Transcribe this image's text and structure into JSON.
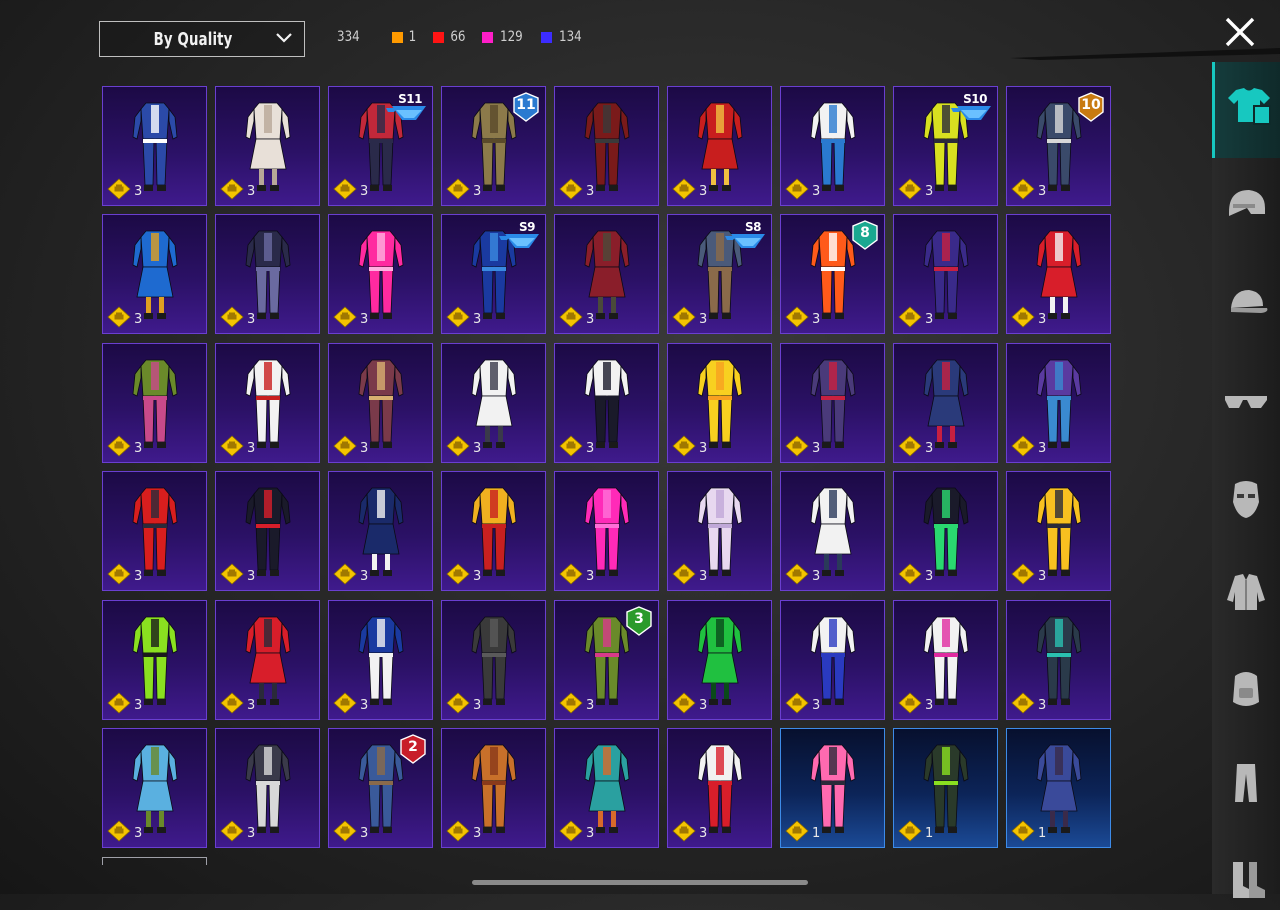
{
  "header": {
    "sort_label": "By Quality",
    "total": "334",
    "counts": [
      {
        "value": "1",
        "color": "#ff9a00"
      },
      {
        "value": "66",
        "color": "#ff1414"
      },
      {
        "value": "129",
        "color": "#ff1ec8"
      },
      {
        "value": "134",
        "color": "#3c2cff"
      }
    ]
  },
  "colors": {
    "accent": "#17c8c0",
    "tile_purple": "#3f1a8c",
    "tile_blue": "#1b4a96",
    "badge_gold": "#f4c400"
  },
  "sidebar": {
    "items": [
      {
        "icon": "outfit-icon",
        "active": true
      },
      {
        "icon": "helmet-icon",
        "active": false
      },
      {
        "icon": "cap-icon",
        "active": false
      },
      {
        "icon": "glasses-icon",
        "active": false
      },
      {
        "icon": "mask-icon",
        "active": false
      },
      {
        "icon": "jacket-icon",
        "active": false
      },
      {
        "icon": "backpack-icon",
        "active": false
      },
      {
        "icon": "pants-icon",
        "active": false
      },
      {
        "icon": "boots-icon",
        "active": false
      }
    ]
  },
  "items": [
    {
      "qty": "3",
      "tier": "purple",
      "color": "#2b4aa8",
      "accent": "#ffffff"
    },
    {
      "qty": "3",
      "tier": "purple",
      "color": "#e8e0d8",
      "accent": "#b8a898"
    },
    {
      "qty": "3",
      "tier": "purple",
      "color": "#c2283a",
      "accent": "#2a2a4a",
      "season": "S11"
    },
    {
      "qty": "3",
      "tier": "purple",
      "color": "#8c7a4a",
      "accent": "#5a4a2a",
      "rank": "11"
    },
    {
      "qty": "3",
      "tier": "purple",
      "color": "#7a1a1a",
      "accent": "#3a3a3a"
    },
    {
      "qty": "3",
      "tier": "purple",
      "color": "#c81e1e",
      "accent": "#f0c040"
    },
    {
      "qty": "3",
      "tier": "purple",
      "color": "#f2f2f2",
      "accent": "#2a7ad0"
    },
    {
      "qty": "3",
      "tier": "purple",
      "color": "#d8e020",
      "accent": "#2a2a3a",
      "season": "S10"
    },
    {
      "qty": "3",
      "tier": "purple",
      "color": "#3a4a6a",
      "accent": "#d8d8d8",
      "rank": "10"
    },
    {
      "qty": "3",
      "tier": "purple",
      "color": "#1e6ad0",
      "accent": "#e0a020"
    },
    {
      "qty": "3",
      "tier": "purple",
      "color": "#2a2a4a",
      "accent": "#6a6aa0"
    },
    {
      "qty": "3",
      "tier": "purple",
      "color": "#ff2aa0",
      "accent": "#ffb0e0"
    },
    {
      "qty": "3",
      "tier": "purple",
      "color": "#1a3aa0",
      "accent": "#3a8ae0",
      "season": "S9"
    },
    {
      "qty": "3",
      "tier": "purple",
      "color": "#8a1e2a",
      "accent": "#4a4a3a"
    },
    {
      "qty": "3",
      "tier": "purple",
      "color": "#4a5a7a",
      "accent": "#8a6a4a",
      "season": "S8"
    },
    {
      "qty": "3",
      "tier": "purple",
      "color": "#ff5a1a",
      "accent": "#ffffff",
      "rank": "8"
    },
    {
      "qty": "3",
      "tier": "purple",
      "color": "#3a2a8a",
      "accent": "#c82040"
    },
    {
      "qty": "3",
      "tier": "purple",
      "color": "#d81e2a",
      "accent": "#f2f2f2"
    },
    {
      "qty": "3",
      "tier": "purple",
      "color": "#6a8a2a",
      "accent": "#c84a8a"
    },
    {
      "qty": "3",
      "tier": "purple",
      "color": "#f2f2f2",
      "accent": "#c81e1e"
    },
    {
      "qty": "3",
      "tier": "purple",
      "color": "#7a3a4a",
      "accent": "#d8b070"
    },
    {
      "qty": "3",
      "tier": "purple",
      "color": "#f2f2f2",
      "accent": "#3a3a4a"
    },
    {
      "qty": "3",
      "tier": "purple",
      "color": "#f2f2f2",
      "accent": "#1a1a2a"
    },
    {
      "qty": "3",
      "tier": "purple",
      "color": "#f8d020",
      "accent": "#f8a020"
    },
    {
      "qty": "3",
      "tier": "purple",
      "color": "#4a3a7a",
      "accent": "#c82040"
    },
    {
      "qty": "3",
      "tier": "purple",
      "color": "#2a3a7a",
      "accent": "#c82040"
    },
    {
      "qty": "3",
      "tier": "purple",
      "color": "#5a3aa0",
      "accent": "#3a8ad0"
    },
    {
      "qty": "3",
      "tier": "purple",
      "color": "#d81e1e",
      "accent": "#2a2a3a"
    },
    {
      "qty": "3",
      "tier": "purple",
      "color": "#1a1a2a",
      "accent": "#d81e2a"
    },
    {
      "qty": "3",
      "tier": "purple",
      "color": "#1a2a6a",
      "accent": "#f2f2f2"
    },
    {
      "qty": "3",
      "tier": "purple",
      "color": "#f0b020",
      "accent": "#c82020"
    },
    {
      "qty": "3",
      "tier": "purple",
      "color": "#ff2ab8",
      "accent": "#ff70d8"
    },
    {
      "qty": "3",
      "tier": "purple",
      "color": "#e8d8f0",
      "accent": "#c0a8d8"
    },
    {
      "qty": "3",
      "tier": "purple",
      "color": "#f2f2f2",
      "accent": "#2a3a5a"
    },
    {
      "qty": "3",
      "tier": "purple",
      "color": "#1a1a2a",
      "accent": "#2ad870"
    },
    {
      "qty": "3",
      "tier": "purple",
      "color": "#f8c020",
      "accent": "#2a2a3a"
    },
    {
      "qty": "3",
      "tier": "purple",
      "color": "#8ae020",
      "accent": "#1a1a1a"
    },
    {
      "qty": "3",
      "tier": "purple",
      "color": "#d81e2a",
      "accent": "#2a2a3a"
    },
    {
      "qty": "3",
      "tier": "purple",
      "color": "#1a3aa0",
      "accent": "#f2f2f2"
    },
    {
      "qty": "3",
      "tier": "purple",
      "color": "#3a3a3a",
      "accent": "#5a5a5a"
    },
    {
      "qty": "3",
      "tier": "purple",
      "color": "#6a8a2a",
      "accent": "#d83a8a",
      "rank": "3"
    },
    {
      "qty": "3",
      "tier": "purple",
      "color": "#20c040",
      "accent": "#0a4a1a"
    },
    {
      "qty": "3",
      "tier": "purple",
      "color": "#f2f2f2",
      "accent": "#2a3ac0"
    },
    {
      "qty": "3",
      "tier": "purple",
      "color": "#f2f2f2",
      "accent": "#e02aa0"
    },
    {
      "qty": "3",
      "tier": "purple",
      "color": "#2a3a4a",
      "accent": "#2ac0b0"
    },
    {
      "qty": "3",
      "tier": "purple",
      "color": "#5ab0e0",
      "accent": "#6a8a2a"
    },
    {
      "qty": "3",
      "tier": "purple",
      "color": "#3a3a4a",
      "accent": "#d8d8d8"
    },
    {
      "qty": "3",
      "tier": "purple",
      "color": "#3a5a9a",
      "accent": "#8a6a4a",
      "rank": "2"
    },
    {
      "qty": "3",
      "tier": "purple",
      "color": "#c8702a",
      "accent": "#8a3a1a"
    },
    {
      "qty": "3",
      "tier": "purple",
      "color": "#2aa0a0",
      "accent": "#d86a2a"
    },
    {
      "qty": "3",
      "tier": "purple",
      "color": "#f2f2f2",
      "accent": "#d81e2a"
    },
    {
      "qty": "1",
      "tier": "blue",
      "color": "#ff6ab0",
      "accent": "#2a2a3a"
    },
    {
      "qty": "1",
      "tier": "blue",
      "color": "#2a3a2a",
      "accent": "#8ae020"
    },
    {
      "qty": "1",
      "tier": "blue",
      "color": "#3a4a9a",
      "accent": "#3a2a4a"
    }
  ]
}
